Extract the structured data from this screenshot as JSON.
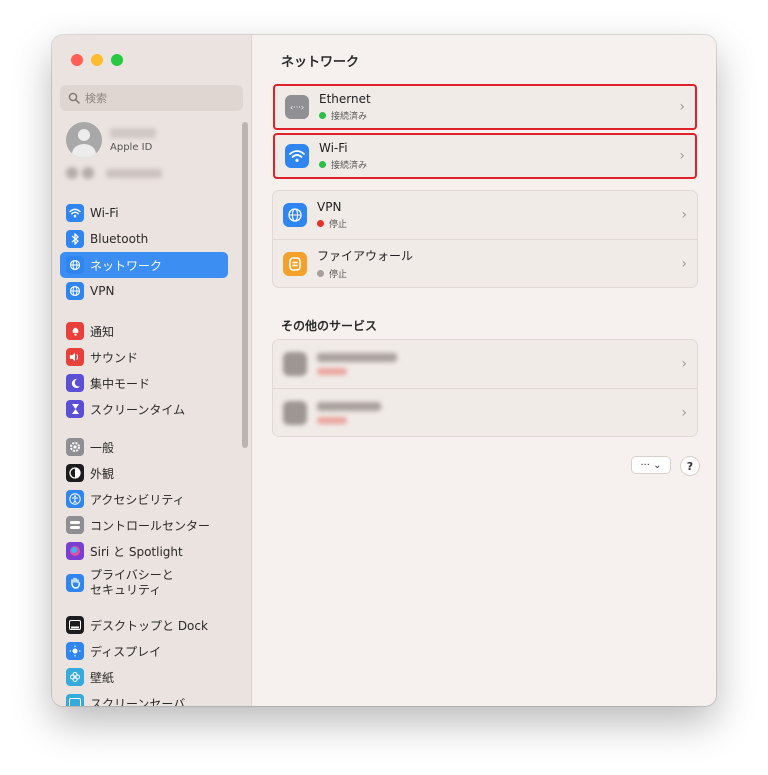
{
  "window": {
    "traffic_lights": [
      "close",
      "minimize",
      "zoom"
    ]
  },
  "sidebar": {
    "search_placeholder": "検索",
    "account": {
      "subtitle": "Apple ID"
    },
    "sections": [
      [
        {
          "label": "Wi-Fi",
          "icon": "wifi-icon",
          "color": "#2f86f0"
        },
        {
          "label": "Bluetooth",
          "icon": "bluetooth-icon",
          "color": "#2f86f0"
        },
        {
          "label": "ネットワーク",
          "icon": "globe-icon",
          "color": "#2f86f0",
          "active": true
        },
        {
          "label": "VPN",
          "icon": "vpn-globe-icon",
          "color": "#2f86f0"
        }
      ],
      [
        {
          "label": "通知",
          "icon": "bell-icon",
          "color": "#e8413b"
        },
        {
          "label": "サウンド",
          "icon": "speaker-icon",
          "color": "#e8413b"
        },
        {
          "label": "集中モード",
          "icon": "moon-icon",
          "color": "#5b4fd6"
        },
        {
          "label": "スクリーンタイム",
          "icon": "hourglass-icon",
          "color": "#5b4fd6"
        }
      ],
      [
        {
          "label": "一般",
          "icon": "gear-icon",
          "color": "#8e8e93"
        },
        {
          "label": "外観",
          "icon": "appearance-icon",
          "color": "#1c1c1e"
        },
        {
          "label": "アクセシビリティ",
          "icon": "accessibility-icon",
          "color": "#2f86f0"
        },
        {
          "label": "コントロールセンター",
          "icon": "control-center-icon",
          "color": "#8e8e93"
        },
        {
          "label": "Siri と Spotlight",
          "icon": "siri-icon",
          "color": "#7a3fd0"
        },
        {
          "label": "プライバシーと\nセキュリティ",
          "icon": "hand-icon",
          "color": "#2f86f0"
        }
      ],
      [
        {
          "label": "デスクトップと Dock",
          "icon": "dock-icon",
          "color": "#1c1c1e"
        },
        {
          "label": "ディスプレイ",
          "icon": "sun-icon",
          "color": "#2f86f0"
        },
        {
          "label": "壁紙",
          "icon": "flower-icon",
          "color": "#35aadc"
        },
        {
          "label": "スクリーンセーバ",
          "icon": "screensaver-icon",
          "color": "#35aadc"
        }
      ]
    ]
  },
  "main": {
    "title": "ネットワーク",
    "connections": [
      {
        "name": "Ethernet",
        "status": "接続済み",
        "status_color": "#2ebd4a",
        "icon": "ethernet-icon",
        "icon_color": "#8f8f94",
        "highlighted": true
      },
      {
        "name": "Wi-Fi",
        "status": "接続済み",
        "status_color": "#2ebd4a",
        "icon": "wifi-icon",
        "icon_color": "#2f86f0",
        "highlighted": true
      }
    ],
    "other_group": [
      {
        "name": "VPN",
        "status": "停止",
        "status_color": "#e5332a",
        "icon": "vpn-globe-icon",
        "icon_color": "#2f86f0"
      },
      {
        "name": "ファイアウォール",
        "status": "停止",
        "status_color": "#a6a09c",
        "icon": "firewall-icon",
        "icon_color": "#f4a12b"
      }
    ],
    "services_title": "その他のサービス",
    "more_button": "··· ⌄",
    "help_button": "?"
  }
}
